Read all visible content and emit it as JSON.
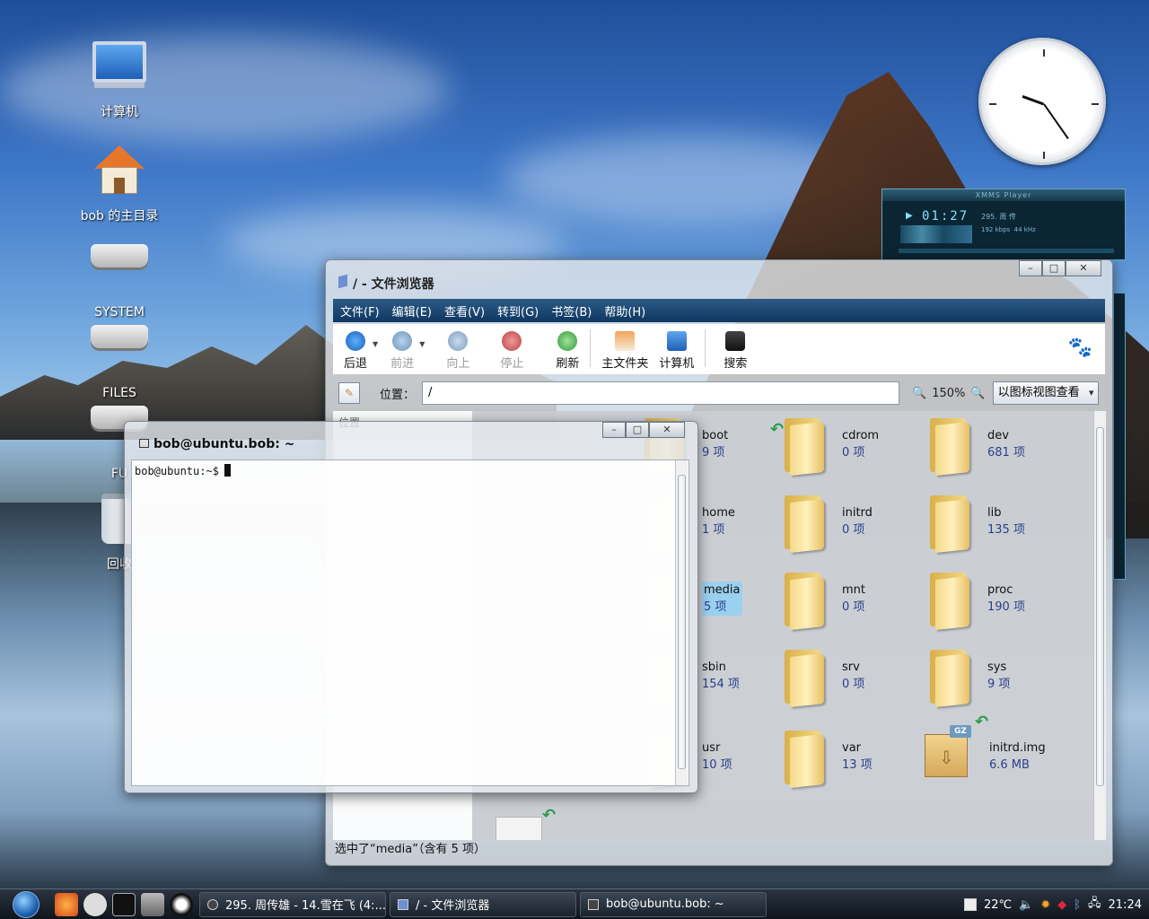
{
  "desktop": {
    "icons": [
      {
        "label": "计算机",
        "icon": "computer-icon"
      },
      {
        "label": "bob 的主目录",
        "icon": "home-folder-icon"
      },
      {
        "label": "SYSTEM",
        "icon": "drive-icon"
      },
      {
        "label": "FILES",
        "icon": "drive-icon"
      },
      {
        "label": "FU",
        "icon": "drive-icon"
      },
      {
        "label": "回收",
        "icon": "trash-icon"
      }
    ]
  },
  "xmms": {
    "title": "XMMS Player",
    "time": "01:27",
    "track_info": "295. 周 传",
    "kbps": "192 kbps",
    "khz": "44 kHz"
  },
  "file_browser": {
    "title": "/ - 文件浏览器",
    "menu": [
      "文件(F)",
      "编辑(E)",
      "查看(V)",
      "转到(G)",
      "书签(B)",
      "帮助(H)"
    ],
    "toolbar": {
      "back": "后退",
      "forward": "前进",
      "up": "向上",
      "stop": "停止",
      "reload": "刷新",
      "home": "主文件夹",
      "computer": "计算机",
      "search": "搜索"
    },
    "location": {
      "label": "位置：",
      "value": "/",
      "zoom": "150%",
      "view_mode": "以图标视图查看"
    },
    "sidebar_header": "位置",
    "items": [
      {
        "name": "boot",
        "count": "9 项"
      },
      {
        "name": "cdrom",
        "count": "0 项"
      },
      {
        "name": "dev",
        "count": "681 项"
      },
      {
        "name": "home",
        "count": "1 项"
      },
      {
        "name": "initrd",
        "count": "0 项"
      },
      {
        "name": "lib",
        "count": "135 项"
      },
      {
        "name": "media",
        "count": "5 项"
      },
      {
        "name": "mnt",
        "count": "0 项"
      },
      {
        "name": "proc",
        "count": "190 项"
      },
      {
        "name": "sbin",
        "count": "154 项"
      },
      {
        "name": "srv",
        "count": "0 项"
      },
      {
        "name": "sys",
        "count": "9 项"
      },
      {
        "name": "usr",
        "count": "10 项"
      },
      {
        "name": "var",
        "count": "13 项"
      },
      {
        "name": "initrd.img",
        "count": "6.6 MB"
      }
    ],
    "status": "选中了“media”（含有 5 项）"
  },
  "terminal": {
    "title": "bob@ubuntu.bob: ~",
    "prompt": "bob@ubuntu:~$"
  },
  "taskbar": {
    "tasks": [
      {
        "label": "295. 周传雄 - 14.雪在飞 (4:..."
      },
      {
        "label": "/ - 文件浏览器"
      },
      {
        "label": "bob@ubuntu.bob: ~"
      }
    ],
    "temperature": "22℃",
    "clock": "21:24"
  }
}
